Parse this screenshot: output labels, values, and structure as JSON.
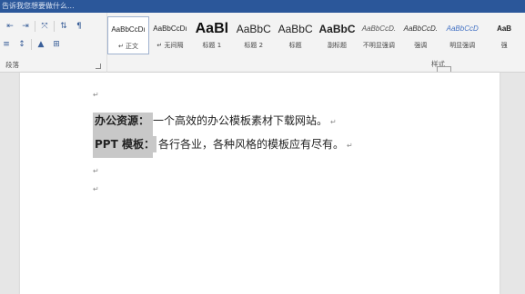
{
  "titlebar": {
    "search_hint": "告诉我您想要做什么..."
  },
  "ribbon": {
    "paragraph_group_label": "段落",
    "styles_group_label": "样式",
    "styles": [
      {
        "preview": "AaBbCcDı",
        "name": "↵ 正文",
        "size": "8px",
        "weight": "normal",
        "italic": false,
        "color": "#222222",
        "selected": true
      },
      {
        "preview": "AaBbCcDı",
        "name": "↵ 无间隔",
        "size": "8px",
        "weight": "normal",
        "italic": false,
        "color": "#222222",
        "selected": false
      },
      {
        "preview": "AaBl",
        "name": "标题 1",
        "size": "16px",
        "weight": "bold",
        "italic": false,
        "color": "#111111",
        "selected": false
      },
      {
        "preview": "AaBbC",
        "name": "标题 2",
        "size": "12px",
        "weight": "normal",
        "italic": false,
        "color": "#222222",
        "selected": false
      },
      {
        "preview": "AaBbC",
        "name": "标题",
        "size": "12px",
        "weight": "normal",
        "italic": false,
        "color": "#222222",
        "selected": false
      },
      {
        "preview": "AaBbC",
        "name": "副标题",
        "size": "12px",
        "weight": "bold",
        "italic": false,
        "color": "#222222",
        "selected": false
      },
      {
        "preview": "AaBbCcD.",
        "name": "不明显强调",
        "size": "8px",
        "weight": "normal",
        "italic": true,
        "color": "#555555",
        "selected": false
      },
      {
        "preview": "AaBbCcD.",
        "name": "强调",
        "size": "8px",
        "weight": "normal",
        "italic": true,
        "color": "#333333",
        "selected": false
      },
      {
        "preview": "AaBbCcD",
        "name": "明显强调",
        "size": "8px",
        "weight": "normal",
        "italic": true,
        "color": "#4472c4",
        "selected": false
      },
      {
        "preview": "AaB",
        "name": "强",
        "size": "8px",
        "weight": "bold",
        "italic": false,
        "color": "#222222",
        "selected": false
      }
    ]
  },
  "document": {
    "lines": [
      {
        "label": "办公资源：",
        "desc": "一个高效的办公模板素材下载网站。"
      },
      {
        "label": "PPT 模板：",
        "desc": "各行各业，各种风格的模板应有尽有。"
      }
    ],
    "paragraph_mark": "↵"
  }
}
